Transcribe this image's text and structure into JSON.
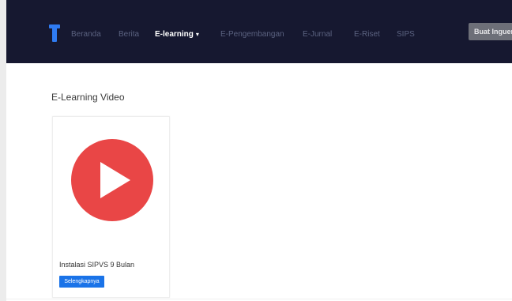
{
  "navbar": {
    "items": [
      {
        "label": "Beranda"
      },
      {
        "label": "Berita"
      },
      {
        "label": "E-learning",
        "active": true,
        "caret": "▾"
      },
      {
        "label": "E-Pengembangan"
      },
      {
        "label": "E-Jurnal"
      },
      {
        "label": "E-Riset"
      },
      {
        "label": "SIPS"
      }
    ],
    "button_label": "Buat Inguer"
  },
  "main": {
    "section_title": "E-Learning Video",
    "cards": [
      {
        "title": "Instalasi SIPVS 9 Bulan",
        "button_label": "Selengkapnya",
        "icon": "play-icon"
      }
    ]
  },
  "colors": {
    "navbar_bg": "#161830",
    "nav_inactive": "#5b6280",
    "play_red": "#e94646",
    "button_blue": "#1a73e8"
  }
}
